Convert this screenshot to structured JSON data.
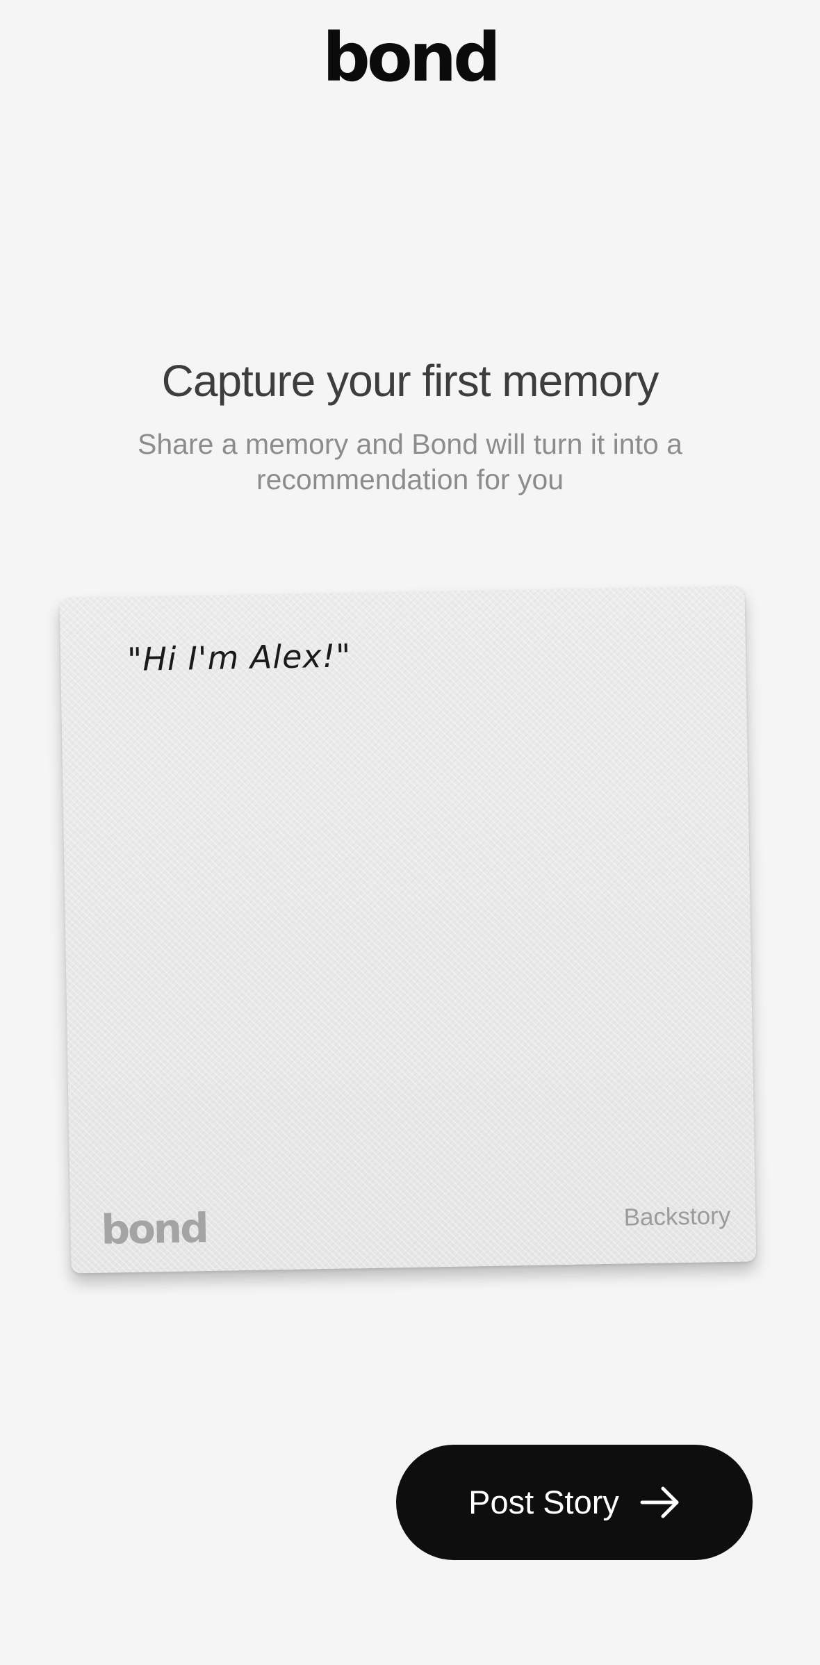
{
  "header": {
    "logo_text": "bond"
  },
  "onboarding": {
    "title": "Capture your first memory",
    "subtitle": "Share a memory and Bond will turn it into a recommendation for you"
  },
  "story_card": {
    "quote": "\"Hi I'm Alex!\"",
    "brand": "bond",
    "tag": "Backstory"
  },
  "actions": {
    "post_label": "Post Story",
    "post_icon": "arrow-right-icon"
  },
  "colors": {
    "background": "#f5f5f5",
    "button": "#0e0e0e",
    "card": "#e9e9e9"
  }
}
